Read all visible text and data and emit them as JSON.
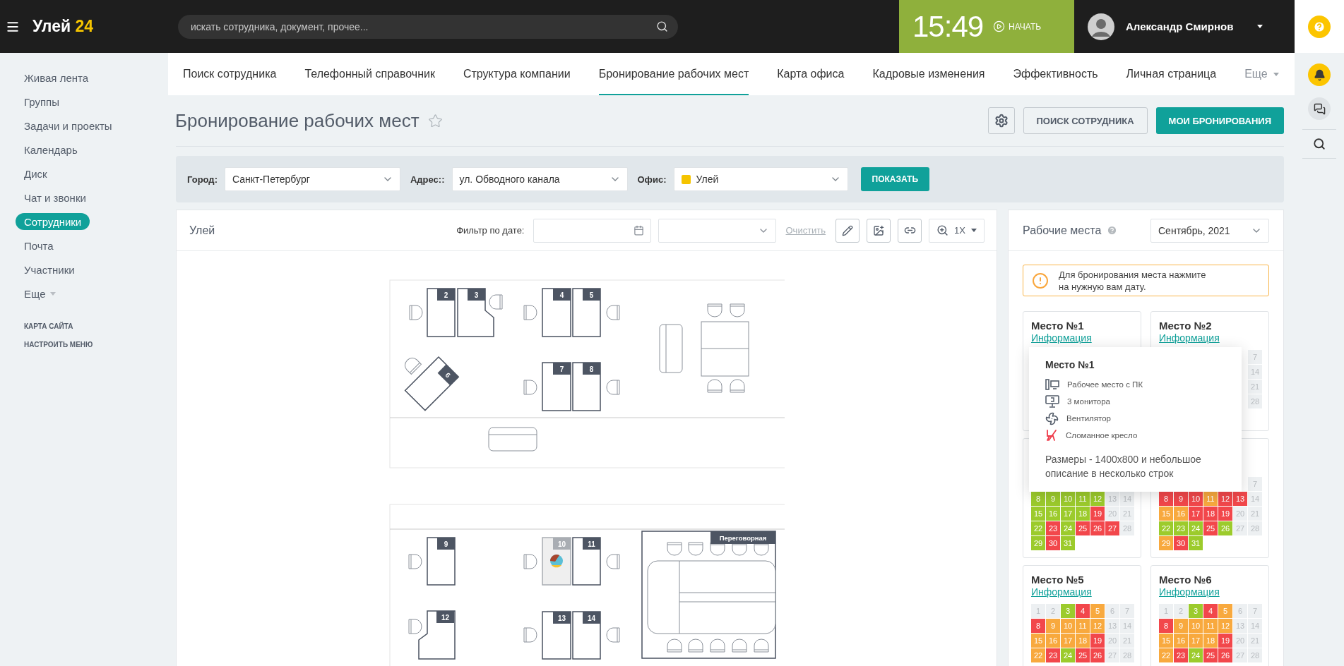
{
  "header": {
    "logo": {
      "name": "Улей",
      "number": "24"
    },
    "search": {
      "placeholder": "искать сотрудника, документ, прочее..."
    },
    "clock": {
      "time": "15:49",
      "action": "НАЧАТЬ"
    },
    "user": {
      "name": "Александр Смирнов"
    }
  },
  "sidebar": {
    "items": [
      {
        "label": "Живая лента",
        "selected": false
      },
      {
        "label": "Группы",
        "selected": false
      },
      {
        "label": "Задачи и проекты",
        "selected": false
      },
      {
        "label": "Календарь",
        "selected": false
      },
      {
        "label": "Диск",
        "selected": false
      },
      {
        "label": "Чат и звонки",
        "selected": false
      },
      {
        "label": "Сотрудники",
        "selected": true
      },
      {
        "label": "Почта",
        "selected": false
      },
      {
        "label": "Участники",
        "selected": false
      }
    ],
    "more": "Еще",
    "links": [
      "КАРТА САЙТА",
      "НАСТРОИТЬ МЕНЮ"
    ]
  },
  "tabs": [
    {
      "label": "Поиск сотрудника",
      "selected": false
    },
    {
      "label": "Телефонный справочник",
      "selected": false
    },
    {
      "label": "Структура компании",
      "selected": false
    },
    {
      "label": "Бронирование рабочих мест",
      "selected": true
    },
    {
      "label": "Карта офиса",
      "selected": false
    },
    {
      "label": "Кадровые изменения",
      "selected": false
    },
    {
      "label": "Эффективность",
      "selected": false
    },
    {
      "label": "Личная страница",
      "selected": false
    }
  ],
  "tabs_more": "Еще",
  "page": {
    "title": "Бронирование рабочих мест",
    "buttons": [
      "ПОИСК СОТРУДНИКА",
      "МОИ БРОНИРОВАНИЯ"
    ]
  },
  "filters": {
    "fields": [
      {
        "label": "Город:",
        "value": "Санкт-Петербург"
      },
      {
        "label": "Адрес::",
        "value": "ул. Обводного канала"
      },
      {
        "label": "Офис:",
        "value": "Улей",
        "kind": "office"
      }
    ],
    "button": "ПОКАЗАТЬ"
  },
  "map": {
    "title": "Улей",
    "date_filter_label": "Фильтр по дате:",
    "clear": "Очистить",
    "zoom": "1X",
    "room_label": "Переговорная",
    "desks": [
      {
        "number": "2",
        "occupied": false
      },
      {
        "number": "3",
        "occupied": false
      },
      {
        "number": "4",
        "occupied": false
      },
      {
        "number": "5",
        "occupied": false
      },
      {
        "number": "6",
        "occupied": false
      },
      {
        "number": "7",
        "occupied": false
      },
      {
        "number": "8",
        "occupied": false
      },
      {
        "number": "9",
        "occupied": false
      },
      {
        "number": "10",
        "occupied": true
      },
      {
        "number": "11",
        "occupied": false
      },
      {
        "number": "12",
        "occupied": false
      },
      {
        "number": "13",
        "occupied": false
      },
      {
        "number": "14",
        "occupied": false
      }
    ]
  },
  "places": {
    "title": "Рабочие места",
    "month": "Сентябрь, 2021",
    "notice": "Для бронирования места нажмите на нужную вам дату.",
    "rows": [
      [
        {
          "title": "Место №1",
          "link": "Информация"
        },
        {
          "title": "Место №2",
          "link": "Информация",
          "weeks": [
            [
              {
                "day": "7",
                "color": "#edf0f2"
              }
            ],
            [
              {
                "day": "14",
                "color": "#edf0f2"
              }
            ],
            [
              {
                "day": "21",
                "color": "#edf0f2"
              }
            ],
            [
              {
                "day": "28",
                "color": "#edf0f2"
              }
            ]
          ]
        }
      ],
      [
        {
          "weeks": [
            [
              {
                "day": "8",
                "color": "#9ccb2c"
              },
              {
                "day": "9",
                "color": "#9ccb2c"
              },
              {
                "day": "10",
                "color": "#9ccb2c"
              },
              {
                "day": "11",
                "color": "#9ccb2c"
              },
              {
                "day": "12",
                "color": "#9ccb2c"
              },
              {
                "day": "13",
                "color": "#edf0f2"
              },
              {
                "day": "14",
                "color": "#edf0f2"
              }
            ],
            [
              {
                "day": "15",
                "color": "#9ccb2c"
              },
              {
                "day": "16",
                "color": "#9ccb2c"
              },
              {
                "day": "17",
                "color": "#9ccb2c"
              },
              {
                "day": "18",
                "color": "#9ccb2c"
              },
              {
                "day": "19",
                "color": "#f2474b"
              },
              {
                "day": "20",
                "color": "#edf0f2"
              },
              {
                "day": "21",
                "color": "#edf0f2"
              }
            ],
            [
              {
                "day": "22",
                "color": "#9ccb2c"
              },
              {
                "day": "23",
                "color": "#f2474b"
              },
              {
                "day": "24",
                "color": "#9ccb2c"
              },
              {
                "day": "25",
                "color": "#f2474b"
              },
              {
                "day": "26",
                "color": "#f2474b"
              },
              {
                "day": "27",
                "color": "#f2474b"
              },
              {
                "day": "28",
                "color": "#edf0f2"
              }
            ],
            [
              {
                "day": "29",
                "color": "#9ccb2c"
              },
              {
                "day": "30",
                "color": "#f2474b"
              },
              {
                "day": "31",
                "color": "#9ccb2c"
              }
            ]
          ]
        },
        {
          "weeks": [
            [
              {
                "day": "7",
                "color": "#edf0f2"
              }
            ],
            [
              {
                "day": "8",
                "color": "#f2474b"
              },
              {
                "day": "9",
                "color": "#f2474b"
              },
              {
                "day": "10",
                "color": "#f2474b"
              },
              {
                "day": "11",
                "color": "#f8a93e"
              },
              {
                "day": "12",
                "color": "#f2474b"
              },
              {
                "day": "13",
                "color": "#f2474b"
              },
              {
                "day": "14",
                "color": "#edf0f2"
              }
            ],
            [
              {
                "day": "15",
                "color": "#f8a93e"
              },
              {
                "day": "16",
                "color": "#f8a93e"
              },
              {
                "day": "17",
                "color": "#f2474b"
              },
              {
                "day": "18",
                "color": "#f2474b"
              },
              {
                "day": "19",
                "color": "#f2474b"
              },
              {
                "day": "20",
                "color": "#edf0f2"
              },
              {
                "day": "21",
                "color": "#edf0f2"
              }
            ],
            [
              {
                "day": "22",
                "color": "#9ccb2c"
              },
              {
                "day": "23",
                "color": "#9ccb2c"
              },
              {
                "day": "24",
                "color": "#9ccb2c"
              },
              {
                "day": "25",
                "color": "#f2474b"
              },
              {
                "day": "26",
                "color": "#9ccb2c"
              },
              {
                "day": "27",
                "color": "#edf0f2"
              },
              {
                "day": "28",
                "color": "#edf0f2"
              }
            ],
            [
              {
                "day": "29",
                "color": "#f8a93e"
              },
              {
                "day": "30",
                "color": "#f2474b"
              },
              {
                "day": "31",
                "color": "#9ccb2c"
              }
            ]
          ]
        }
      ],
      [
        {
          "title": "Место №5",
          "link": "Информация",
          "weeks": [
            [
              {
                "day": "1",
                "color": "#edf0f2"
              },
              {
                "day": "2",
                "color": "#edf0f2"
              },
              {
                "day": "3",
                "color": "#9ccb2c"
              },
              {
                "day": "4",
                "color": "#f2474b"
              },
              {
                "day": "5",
                "color": "#f8a93e"
              },
              {
                "day": "6",
                "color": "#edf0f2"
              },
              {
                "day": "7",
                "color": "#edf0f2"
              }
            ],
            [
              {
                "day": "8",
                "color": "#f2474b"
              },
              {
                "day": "9",
                "color": "#f8a93e"
              },
              {
                "day": "10",
                "color": "#f8a93e"
              },
              {
                "day": "11",
                "color": "#f8a93e"
              },
              {
                "day": "12",
                "color": "#f8a93e"
              },
              {
                "day": "13",
                "color": "#edf0f2"
              },
              {
                "day": "14",
                "color": "#edf0f2"
              }
            ],
            [
              {
                "day": "15",
                "color": "#f8a93e"
              },
              {
                "day": "16",
                "color": "#f8a93e"
              },
              {
                "day": "17",
                "color": "#f8a93e"
              },
              {
                "day": "18",
                "color": "#f8a93e"
              },
              {
                "day": "19",
                "color": "#f2474b"
              },
              {
                "day": "20",
                "color": "#edf0f2"
              },
              {
                "day": "21",
                "color": "#edf0f2"
              }
            ],
            [
              {
                "day": "22",
                "color": "#f8a93e"
              },
              {
                "day": "23",
                "color": "#f2474b"
              },
              {
                "day": "24",
                "color": "#9ccb2c"
              },
              {
                "day": "25",
                "color": "#f2474b"
              },
              {
                "day": "26",
                "color": "#f2474b"
              },
              {
                "day": "27",
                "color": "#edf0f2"
              },
              {
                "day": "28",
                "color": "#edf0f2"
              }
            ]
          ]
        },
        {
          "title": "Место №6",
          "link": "Информация",
          "weeks": [
            [
              {
                "day": "1",
                "color": "#edf0f2"
              },
              {
                "day": "2",
                "color": "#edf0f2"
              },
              {
                "day": "3",
                "color": "#9ccb2c"
              },
              {
                "day": "4",
                "color": "#f2474b"
              },
              {
                "day": "5",
                "color": "#f8a93e"
              },
              {
                "day": "6",
                "color": "#edf0f2"
              },
              {
                "day": "7",
                "color": "#edf0f2"
              }
            ],
            [
              {
                "day": "8",
                "color": "#f2474b"
              },
              {
                "day": "9",
                "color": "#f8a93e"
              },
              {
                "day": "10",
                "color": "#f8a93e"
              },
              {
                "day": "11",
                "color": "#f8a93e"
              },
              {
                "day": "12",
                "color": "#f8a93e"
              },
              {
                "day": "13",
                "color": "#edf0f2"
              },
              {
                "day": "14",
                "color": "#edf0f2"
              }
            ],
            [
              {
                "day": "15",
                "color": "#f8a93e"
              },
              {
                "day": "16",
                "color": "#f8a93e"
              },
              {
                "day": "17",
                "color": "#f8a93e"
              },
              {
                "day": "18",
                "color": "#f8a93e"
              },
              {
                "day": "19",
                "color": "#f2474b"
              },
              {
                "day": "20",
                "color": "#edf0f2"
              },
              {
                "day": "21",
                "color": "#edf0f2"
              }
            ],
            [
              {
                "day": "22",
                "color": "#f8a93e"
              },
              {
                "day": "23",
                "color": "#f2474b"
              },
              {
                "day": "24",
                "color": "#9ccb2c"
              },
              {
                "day": "25",
                "color": "#f2474b"
              },
              {
                "day": "26",
                "color": "#f2474b"
              },
              {
                "day": "27",
                "color": "#edf0f2"
              },
              {
                "day": "28",
                "color": "#edf0f2"
              }
            ]
          ]
        }
      ]
    ]
  },
  "popup": {
    "title": "Место №1",
    "features": [
      {
        "kind": "pc",
        "label": "Рабочее место с ПК"
      },
      {
        "kind": "monitors",
        "label": "3 монитора"
      },
      {
        "kind": "fan",
        "label": "Вентилятор"
      },
      {
        "kind": "broken_chair",
        "label": "Сломанное кресло"
      }
    ],
    "description": "Размеры - 1400x800 и небольшое описание в несколько строк"
  }
}
